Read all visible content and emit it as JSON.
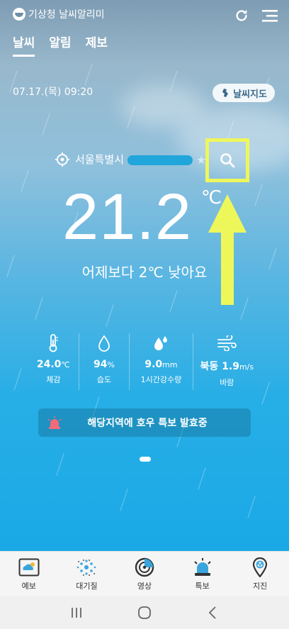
{
  "app": {
    "brand": "기상청 날씨알리미"
  },
  "tabs": [
    {
      "label": "날씨",
      "active": true
    },
    {
      "label": "알림",
      "active": false
    },
    {
      "label": "제보",
      "active": false
    }
  ],
  "date": "07.17.(목) 09:20",
  "weather_map_button": "날씨지도",
  "location": "서울특별시",
  "temperature": {
    "value": "21.2",
    "unit": "℃"
  },
  "comparison": "어제보다 2℃ 낮아요",
  "stats": [
    {
      "icon": "thermometer-icon",
      "value": "24.0",
      "unit": "℃",
      "label": "체감"
    },
    {
      "icon": "humidity-drop-icon",
      "value": "94",
      "unit": "%",
      "label": "습도"
    },
    {
      "icon": "rain-drops-icon",
      "value": "9.0",
      "unit": "mm",
      "label": "1시간강수량"
    },
    {
      "icon": "wind-icon",
      "value": "북동 1.9",
      "unit": "m/s",
      "label": "바람"
    }
  ],
  "alert": "해당지역에 호우 특보 발효중",
  "bottom_nav": [
    {
      "icon": "forecast-icon",
      "label": "예보"
    },
    {
      "icon": "air-quality-icon",
      "label": "대기질"
    },
    {
      "icon": "radar-icon",
      "label": "영상"
    },
    {
      "icon": "warning-siren-icon",
      "label": "특보"
    },
    {
      "icon": "earthquake-pin-icon",
      "label": "지진"
    }
  ],
  "colors": {
    "highlight": "#eef75a",
    "accent": "#1aa9e6"
  }
}
